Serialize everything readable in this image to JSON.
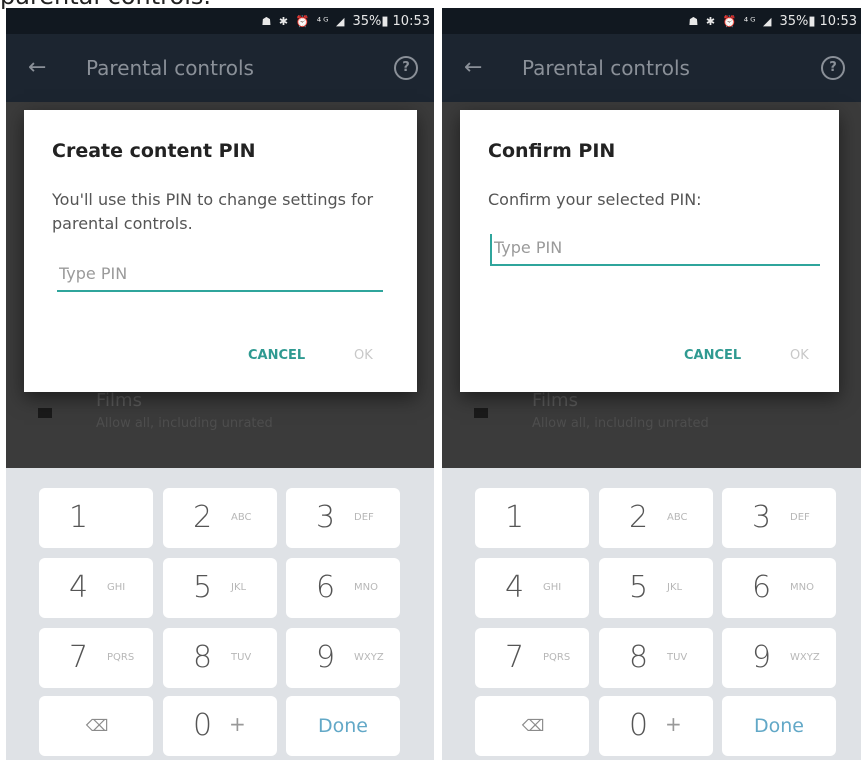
{
  "page_caption": "parental controls.",
  "screens": [
    {
      "status": {
        "icons": "☗ ✱ ⏰ ⁴ᴳ ◢",
        "battery": "35%▮",
        "time": "10:53"
      },
      "app_bar": {
        "title": "Parental controls"
      },
      "background_list": {
        "title": "Films",
        "subtitle": "Allow all, including unrated"
      },
      "dialog": {
        "title": "Create content PIN",
        "message": "You'll use this PIN to change settings for parental controls.",
        "input_placeholder": "Type PIN",
        "input_value": "",
        "cancel_label": "CANCEL",
        "ok_label": "OK"
      }
    },
    {
      "status": {
        "icons": "☗ ✱ ⏰ ⁴ᴳ ◢",
        "battery": "35%▮",
        "time": "10:53"
      },
      "app_bar": {
        "title": "Parental controls"
      },
      "background_list": {
        "title": "Films",
        "subtitle": "Allow all, including unrated"
      },
      "dialog": {
        "title": "Confirm PIN",
        "message": "Confirm your selected PIN:",
        "input_placeholder": "Type PIN",
        "input_value": "",
        "cancel_label": "CANCEL",
        "ok_label": "OK"
      }
    }
  ],
  "keypad": {
    "keys": [
      {
        "digit": "1",
        "letters": ""
      },
      {
        "digit": "2",
        "letters": "ABC"
      },
      {
        "digit": "3",
        "letters": "DEF"
      },
      {
        "digit": "4",
        "letters": "GHI"
      },
      {
        "digit": "5",
        "letters": "JKL"
      },
      {
        "digit": "6",
        "letters": "MNO"
      },
      {
        "digit": "7",
        "letters": "PQRS"
      },
      {
        "digit": "8",
        "letters": "TUV"
      },
      {
        "digit": "9",
        "letters": "WXYZ"
      }
    ],
    "zero": {
      "digit": "0",
      "extra": "+"
    },
    "backspace_icon": "⌫",
    "done_label": "Done"
  },
  "icons": {
    "back": "arrow-left-icon",
    "help": "help-circle-icon",
    "backspace": "backspace-icon",
    "films": "film-icon"
  },
  "colors": {
    "accent": "#2fa59c",
    "done_text": "#62a8c7",
    "app_bar": "#1c2530",
    "status_bar": "#111820",
    "keypad_bg": "#dfe2e6"
  }
}
